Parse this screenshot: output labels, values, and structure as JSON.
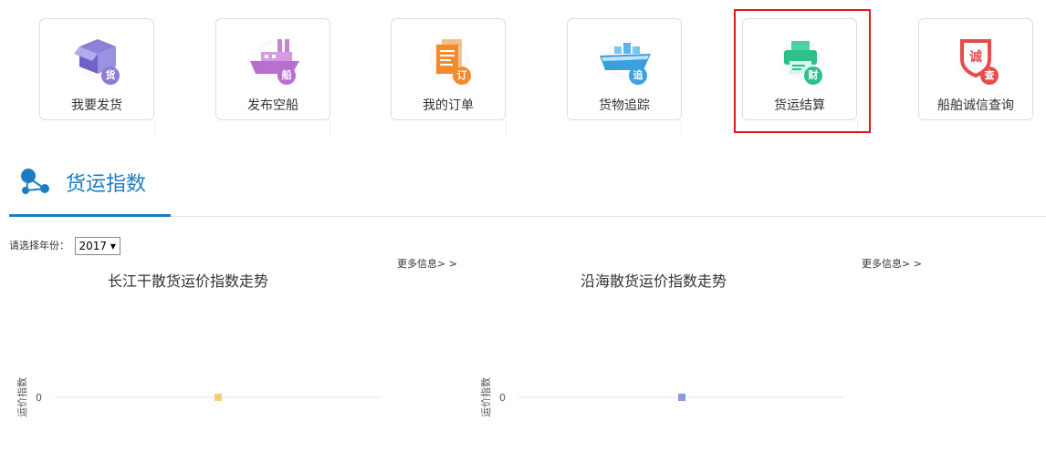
{
  "tiles": [
    {
      "label": "我要发货",
      "badge": "货",
      "icon": "box-icon",
      "badge_color": "#8f7ad6"
    },
    {
      "label": "发布空船",
      "badge": "船",
      "icon": "ship-icon",
      "badge_color": "#b86fd0"
    },
    {
      "label": "我的订单",
      "badge": "订",
      "icon": "document-icon",
      "badge_color": "#f28a2e"
    },
    {
      "label": "货物追踪",
      "badge": "追",
      "icon": "cargo-ship-icon",
      "badge_color": "#3aa0e0"
    },
    {
      "label": "货运结算",
      "badge": "财",
      "icon": "printer-icon",
      "badge_color": "#2cc08a"
    },
    {
      "label": "船舶诚信查询",
      "badge": "查",
      "icon": "shield-search-icon",
      "badge_color": "#e74c4c"
    }
  ],
  "section": {
    "title": "货运指数",
    "icon": "share-nodes-icon"
  },
  "year_filter": {
    "label": "请选择年份：",
    "selected": "2017"
  },
  "more_label": "更多信息> >",
  "chart_data": [
    {
      "type": "line",
      "title": "长江干散货运价指数走势",
      "ylabel": "运价指数",
      "y_ticks": [
        "0"
      ],
      "values": [
        0
      ],
      "marker_color": "#f1c35b"
    },
    {
      "type": "line",
      "title": "沿海散货运价指数走势",
      "ylabel": "运价指数",
      "y_ticks": [
        "0"
      ],
      "values": [
        0
      ],
      "marker_color": "#6c7fd8"
    }
  ]
}
